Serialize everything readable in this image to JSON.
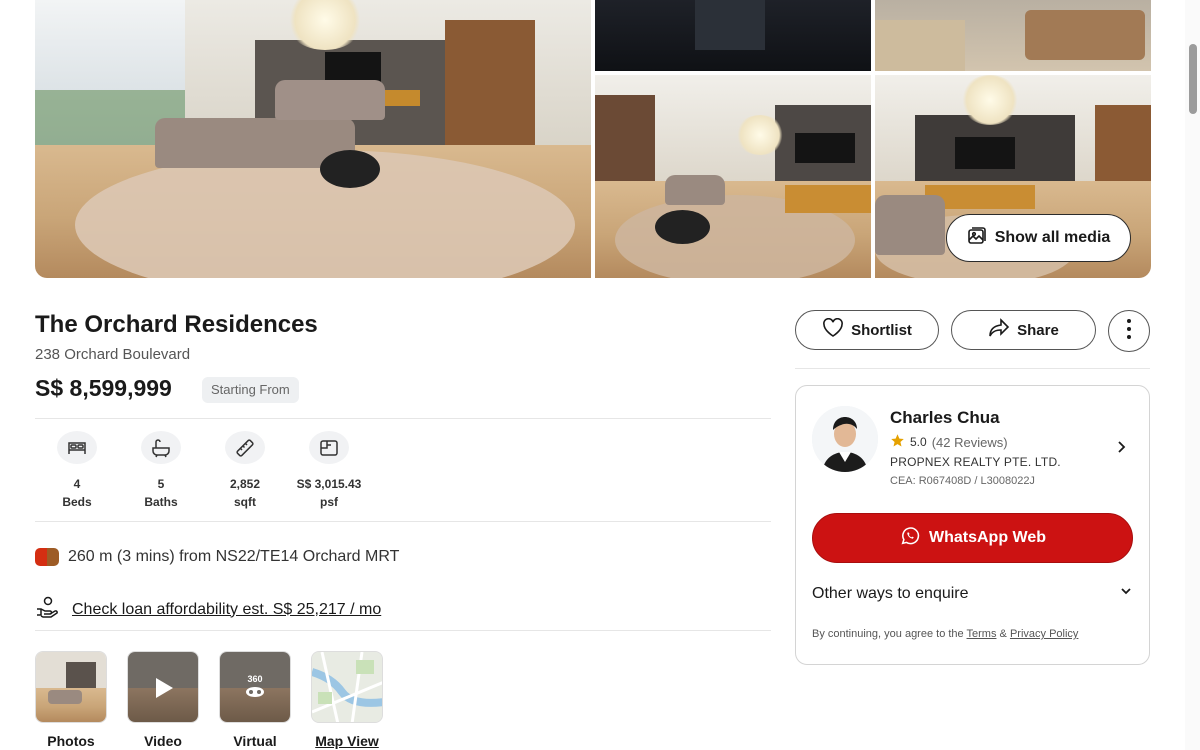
{
  "gallery": {
    "show_all_media_label": "Show all media"
  },
  "listing": {
    "title": "The Orchard Residences",
    "address": "238 Orchard Boulevard",
    "price": "S$ 8,599,999",
    "price_tag": "Starting From",
    "features": [
      {
        "icon": "bed-icon",
        "value": "4",
        "label": "Beds"
      },
      {
        "icon": "bath-icon",
        "value": "5",
        "label": "Baths"
      },
      {
        "icon": "ruler-icon",
        "value": "2,852",
        "label": "sqft"
      },
      {
        "icon": "floorplan-icon",
        "value": "S$ 3,015.43",
        "label": "psf"
      }
    ],
    "mrt_text": "260 m (3 mins) from NS22/TE14 Orchard MRT",
    "mrt_colors": [
      "#d42e12",
      "#9d5b25"
    ],
    "loan_text": "Check loan affordability est. S$ 25,217 / mo",
    "media": [
      {
        "label": "Photos",
        "icon": "photo-thumbnail"
      },
      {
        "label": "Video",
        "icon": "play-icon"
      },
      {
        "label": "Virtual",
        "icon": "360-icon",
        "badge": "360"
      },
      {
        "label": "Map View",
        "icon": "map-thumbnail"
      }
    ]
  },
  "actions": {
    "shortlist_label": "Shortlist",
    "share_label": "Share"
  },
  "agent": {
    "name": "Charles Chua",
    "rating": "5.0",
    "reviews": "(42 Reviews)",
    "agency": "PROPNEX REALTY PTE. LTD.",
    "cea": "CEA: R067408D / L3008022J",
    "whatsapp_label": "WhatsApp Web",
    "other_ways_label": "Other ways to enquire",
    "consent_prefix": "By continuing, you agree to the",
    "terms_label": "Terms",
    "consent_and": "&",
    "privacy_label": "Privacy Policy"
  },
  "colors": {
    "whatsapp_red": "#cc1212",
    "star_gold": "#e5a100"
  }
}
